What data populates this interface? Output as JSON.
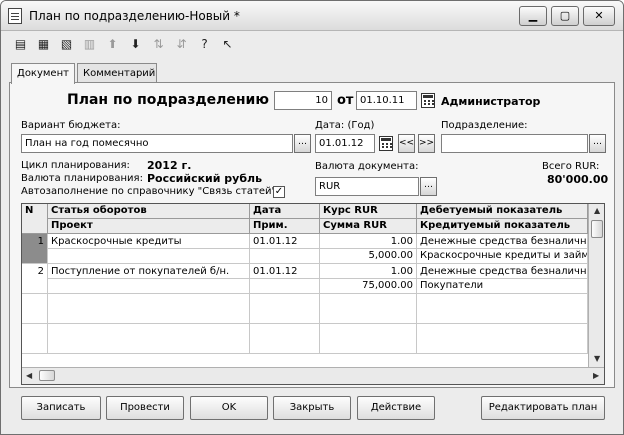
{
  "window": {
    "title": "План по подразделению-Новый *"
  },
  "toolbar": {
    "icons": [
      "new-row-icon",
      "copy-row-icon",
      "delete-row-icon",
      "edit-row-icon",
      "move-up-icon",
      "move-down-icon",
      "sort-asc-icon",
      "sort-desc-icon",
      "help-icon",
      "whats-this-icon"
    ]
  },
  "tabs": [
    "Документ",
    "Комментарий"
  ],
  "header": {
    "title": "План по подразделению №",
    "number": "10",
    "from_label": "от",
    "date": "01.10.11",
    "user": "Администратор"
  },
  "form": {
    "budget_label": "Вариант бюджета:",
    "budget_value": "План на год помесячно",
    "date_label": "Дата: (Год)",
    "date_value": "01.01.12",
    "prev_btn": "<<",
    "next_btn": ">>",
    "dept_label": "Подразделение:",
    "dept_value": "",
    "cycle_label": "Цикл планирования:",
    "cycle_value": "2012 г.",
    "currency_label": "Валюта планирования:",
    "currency_value": "Российский рубль",
    "autofill_label": "Автозаполнение по справочнику \"Связь статей\":",
    "autofill_checked": "✓",
    "doc_currency_label": "Валюта документа:",
    "doc_currency_value": "RUR",
    "total_label": "Всего RUR:",
    "total_value": "80'000.00"
  },
  "table": {
    "headers_top": [
      "N",
      "Статья оборотов",
      "Дата",
      "Курс RUR",
      "Дебетуемый показатель"
    ],
    "headers_bottom": [
      "",
      "Проект",
      "Прим.",
      "Сумма RUR",
      "Кредитуемый показатель"
    ],
    "rows": [
      {
        "n": "1",
        "article": "Краскосрочные  кредиты",
        "date": "01.01.12",
        "rate": "1.00",
        "debit": "Денежные средства безналичн",
        "project": "",
        "note": "",
        "sum": "5,000.00",
        "credit": "Краскосрочные кредиты и займ"
      },
      {
        "n": "2",
        "article": "Поступление от покупателей б/н.",
        "date": "01.01.12",
        "rate": "1.00",
        "debit": "Денежные средства безналичн",
        "project": "",
        "note": "",
        "sum": "75,000.00",
        "credit": "Покупатели"
      }
    ]
  },
  "buttons": {
    "save": "Записать",
    "post": "Провести",
    "ok": "OK",
    "close": "Закрыть",
    "action": "Действие",
    "edit_plan": "Редактировать план"
  }
}
